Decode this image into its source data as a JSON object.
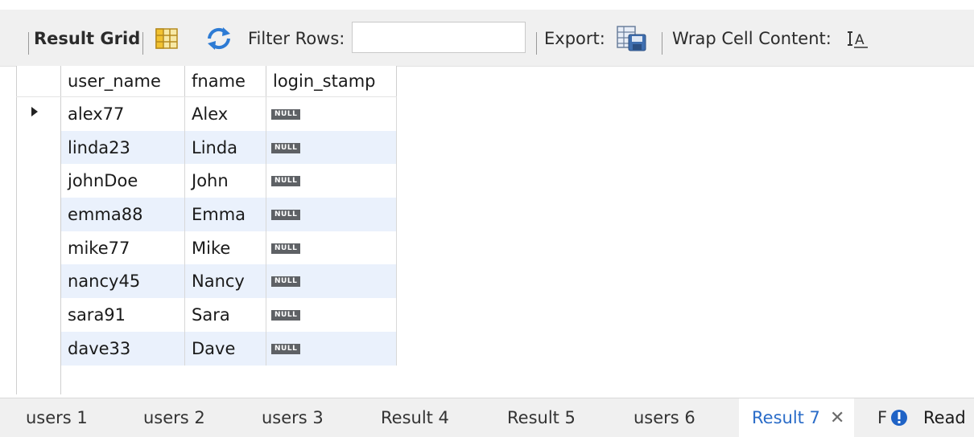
{
  "toolbar": {
    "result_grid_label": "Result Grid",
    "filter_rows_label": "Filter Rows:",
    "filter_value": "",
    "export_label": "Export:",
    "wrap_cell_label": "Wrap Cell Content:"
  },
  "grid": {
    "columns": [
      "user_name",
      "fname",
      "login_stamp"
    ],
    "null_label": "NULL",
    "rows": [
      {
        "user_name": "alex77",
        "fname": "Alex"
      },
      {
        "user_name": "linda23",
        "fname": "Linda"
      },
      {
        "user_name": "johnDoe",
        "fname": "John"
      },
      {
        "user_name": "emma88",
        "fname": "Emma"
      },
      {
        "user_name": "mike77",
        "fname": "Mike"
      },
      {
        "user_name": "nancy45",
        "fname": "Nancy"
      },
      {
        "user_name": "sara91",
        "fname": "Sara"
      },
      {
        "user_name": "dave33",
        "fname": "Dave"
      }
    ]
  },
  "tabs": [
    {
      "label": "users 1"
    },
    {
      "label": "users 2"
    },
    {
      "label": "users 3"
    },
    {
      "label": "Result 4"
    },
    {
      "label": "Result 5"
    },
    {
      "label": "users 6"
    },
    {
      "label": "Result 7"
    },
    {
      "label": "F"
    },
    {
      "label": "Read"
    }
  ],
  "icons": {
    "grid_icon": "grid-view-icon",
    "refresh_icon": "refresh-icon",
    "export_icon": "export-icon",
    "wrap_icon": "wrap-cell-icon",
    "info_icon": "info-icon",
    "close_icon": "close-icon"
  },
  "colors": {
    "accent": "#2a6cc8",
    "row_alt": "#eaf1fc",
    "null_badge": "#5e6165"
  }
}
